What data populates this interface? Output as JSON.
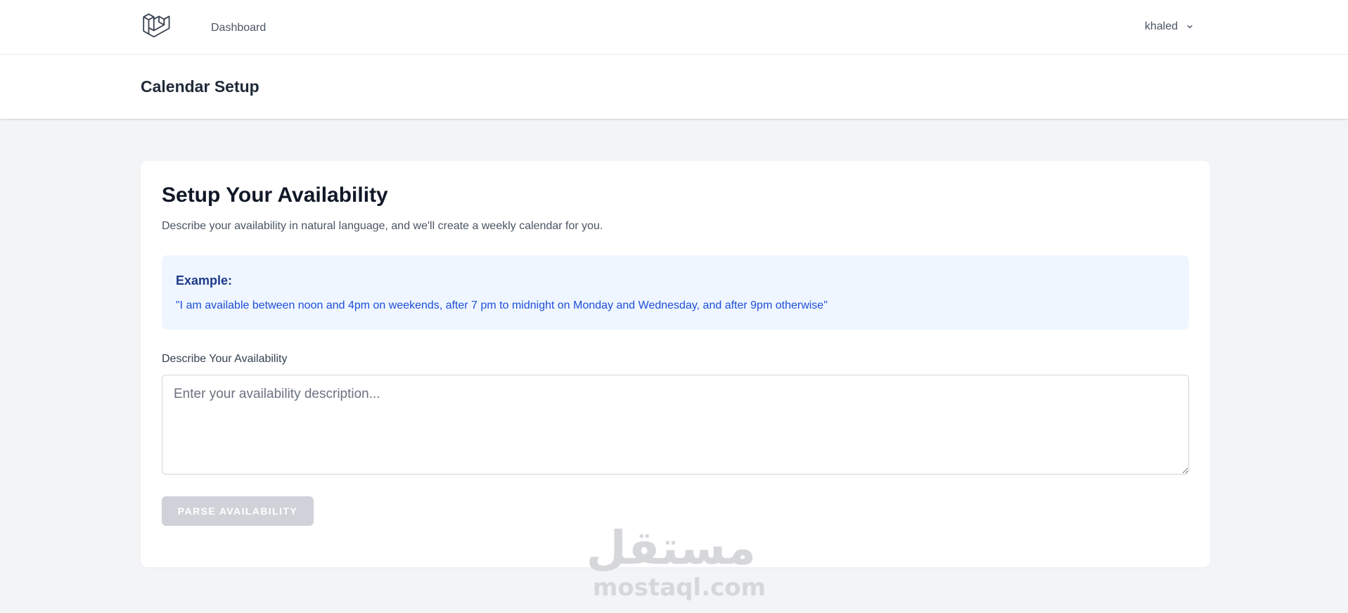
{
  "nav": {
    "logo_icon": "laravel-logo-icon",
    "dashboard_label": "Dashboard",
    "user_name": "khaled",
    "user_chevron_icon": "chevron-down-icon"
  },
  "header": {
    "title": "Calendar Setup"
  },
  "card": {
    "title": "Setup Your Availability",
    "description": "Describe your availability in natural language, and we'll create a weekly calendar for you.",
    "example": {
      "title": "Example:",
      "text": "\"I am available between noon and 4pm on weekends, after 7 pm to midnight on Monday and Wednesday, and after 9pm otherwise\""
    },
    "field_label": "Describe Your Availability",
    "textarea": {
      "value": "",
      "placeholder": "Enter your availability description..."
    },
    "parse_button_label": "PARSE AVAILABILITY"
  },
  "watermark": {
    "arabic": "مستقل",
    "latin": "mostaql.com"
  },
  "colors": {
    "background": "#f3f4f6",
    "example_bg": "#eff6ff",
    "example_title": "#1e3a8a",
    "example_text": "#1d4ed8",
    "button_disabled": "#cfd2d8"
  }
}
